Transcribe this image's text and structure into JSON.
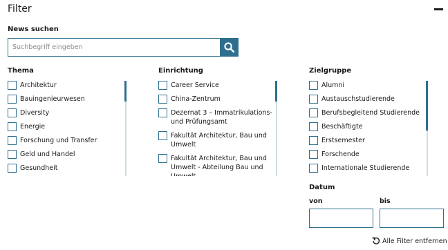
{
  "header": {
    "title": "Filter"
  },
  "search": {
    "label": "News suchen",
    "placeholder": "Suchbegriff eingeben",
    "value": ""
  },
  "thema": {
    "heading": "Thema",
    "items": [
      {
        "label": "Architektur",
        "checked": false
      },
      {
        "label": "Bauingenieurwesen",
        "checked": false
      },
      {
        "label": "Diversity",
        "checked": false
      },
      {
        "label": "Energie",
        "checked": false
      },
      {
        "label": "Forschung und Transfer",
        "checked": false
      },
      {
        "label": "Geld und Handel",
        "checked": false
      },
      {
        "label": "Gesundheit",
        "checked": false
      }
    ]
  },
  "einrichtung": {
    "heading": "Einrichtung",
    "items": [
      {
        "label": "Career Service",
        "checked": false
      },
      {
        "label": "China-Zentrum",
        "checked": false
      },
      {
        "label": "Dezernat 3 – Immatrikulations- und Prüfungsamt",
        "checked": false
      },
      {
        "label": "Fakultät Architektur, Bau und Umwelt",
        "checked": false
      },
      {
        "label": "Fakultät Architektur, Bau und Umwelt - Abteilung Bau und Umwelt",
        "checked": false
      }
    ]
  },
  "zielgruppe": {
    "heading": "Zielgruppe",
    "items": [
      {
        "label": "Alumni",
        "checked": false
      },
      {
        "label": "Austauschstudierende",
        "checked": false
      },
      {
        "label": "Berufsbegleitend Studierende",
        "checked": false
      },
      {
        "label": "Beschäftigte",
        "checked": false
      },
      {
        "label": "Erstsemester",
        "checked": false
      },
      {
        "label": "Forschende",
        "checked": false
      },
      {
        "label": "Internationale Studierende",
        "checked": false
      }
    ]
  },
  "datum": {
    "heading": "Datum",
    "von_label": "von",
    "bis_label": "bis",
    "von_value": "",
    "bis_value": ""
  },
  "reset": {
    "label": "Alle Filter entfernen"
  },
  "colors": {
    "accent": "#2e6f8e",
    "text": "#1a1a1a",
    "scroll_track": "#cfdbe2"
  },
  "icons": {
    "search": "search-icon",
    "collapse": "minus-icon",
    "reset": "reset-icon"
  }
}
